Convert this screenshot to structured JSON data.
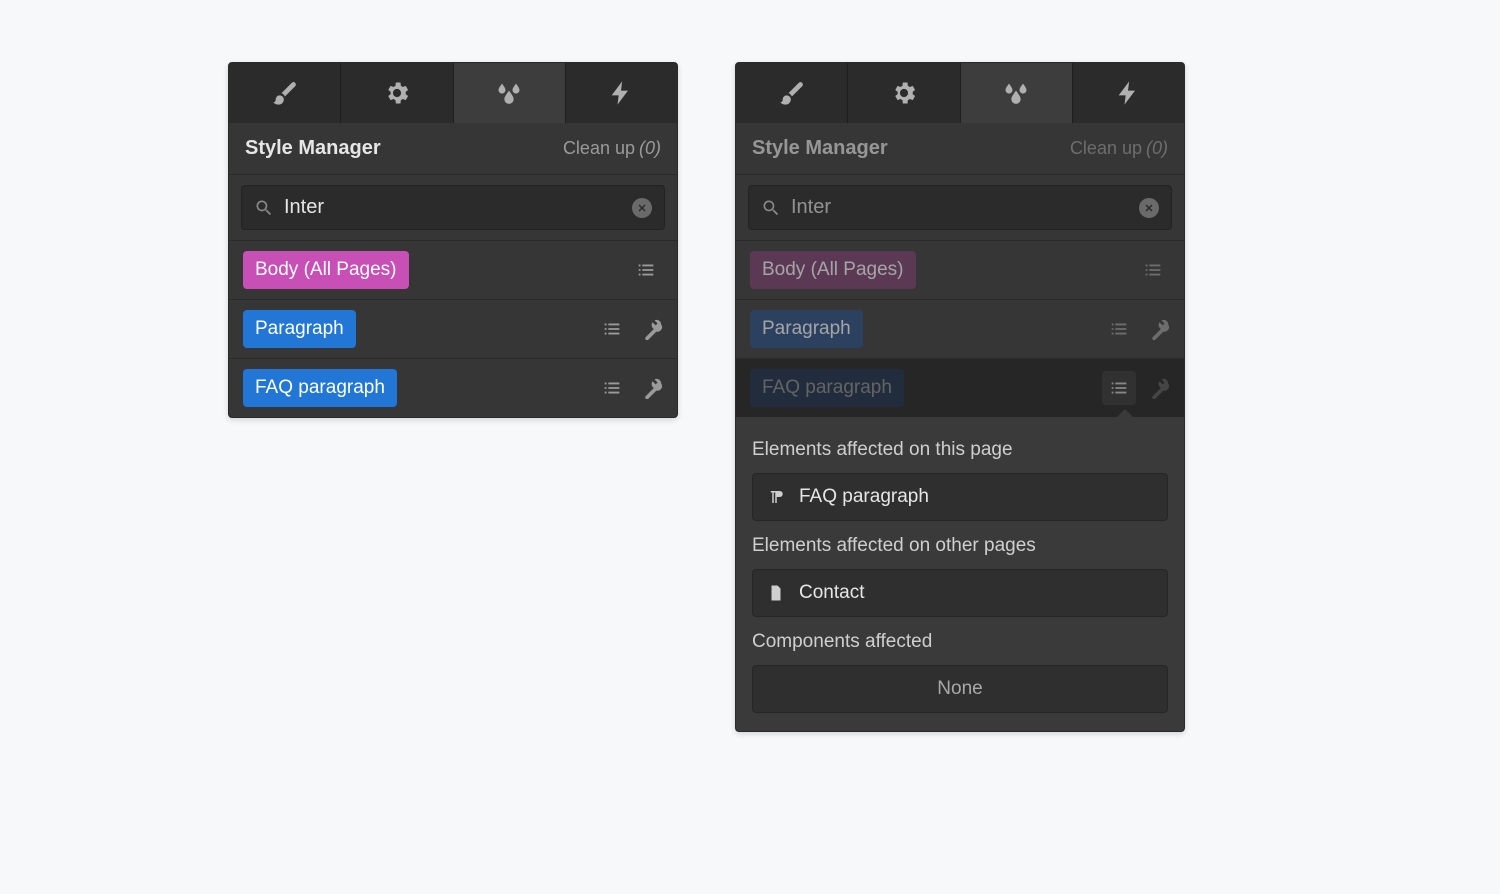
{
  "header": {
    "title": "Style Manager",
    "cleanup_label": "Clean up",
    "cleanup_count": "(0)"
  },
  "search": {
    "value": "Inter"
  },
  "styles": [
    {
      "label": "Body (All Pages)",
      "color": "magenta",
      "has_wrench": false
    },
    {
      "label": "Paragraph",
      "color": "blue",
      "has_wrench": true
    },
    {
      "label": "FAQ paragraph",
      "color": "blue",
      "has_wrench": true
    }
  ],
  "popover": {
    "section1_title": "Elements affected on this page",
    "section1_item": "FAQ paragraph",
    "section2_title": "Elements affected on other pages",
    "section2_item": "Contact",
    "section3_title": "Components affected",
    "none_label": "None"
  }
}
